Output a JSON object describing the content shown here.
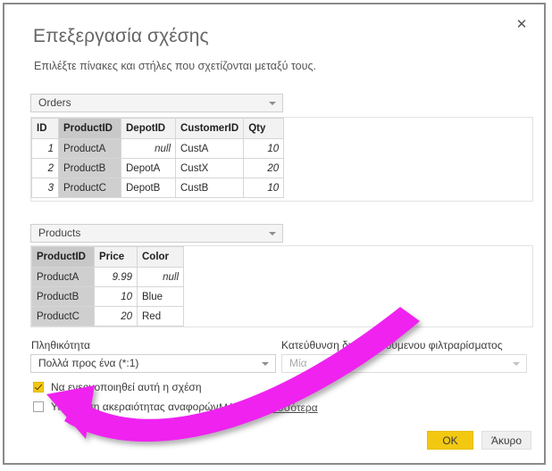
{
  "dialog": {
    "title": "Επεξεργασία σχέσης",
    "subtitle": "Επιλέξτε πίνακες και στήλες που σχετίζονται μεταξύ τους.",
    "close_icon": "close-icon"
  },
  "tables": [
    {
      "select_value": "Orders",
      "chevron_icon": "chevron-down-icon",
      "selected_column": "ProductID",
      "columns": [
        "ID",
        "ProductID",
        "DepotID",
        "CustomerID",
        "Qty"
      ],
      "rows": [
        [
          "1",
          "ProductA",
          "null",
          "CustA",
          "10"
        ],
        [
          "2",
          "ProductB",
          "DepotA",
          "CustX",
          "20"
        ],
        [
          "3",
          "ProductC",
          "DepotB",
          "CustB",
          "10"
        ]
      ]
    },
    {
      "select_value": "Products",
      "chevron_icon": "chevron-down-icon",
      "selected_column": "ProductID",
      "columns": [
        "ProductID",
        "Price",
        "Color"
      ],
      "rows": [
        [
          "ProductA",
          "9.99",
          "null"
        ],
        [
          "ProductB",
          "10",
          "Blue"
        ],
        [
          "ProductC",
          "20",
          "Red"
        ]
      ]
    }
  ],
  "options": {
    "cardinality_label": "Πληθικότητα",
    "cardinality_value": "Πολλά προς ένα (*:1)",
    "cross_filter_label": "Κατεύθυνση διασταυρούμενου φιλτραρίσματος",
    "cross_filter_value": "Μία",
    "active_checkbox_label": "Να ενεργοποιηθεί αυτή η σχέση",
    "active_checkbox_checked": true,
    "integrity_checkbox_label": "Υιοθέτηση ακεραιότητας αναφορών",
    "integrity_checkbox_checked": false,
    "learn_more_link": "Μάθετε περισσότερα"
  },
  "footer": {
    "ok_label": "OK",
    "cancel_label": "Άκυρο"
  },
  "annotation": {
    "arrow_color": "#ef23ef",
    "arrow_target": "Υιοθέτηση ακεραιότητας αναφορών"
  },
  "colors": {
    "accent": "#f2c811",
    "frame_border": "#8a8a8a",
    "title_gray": "#666666",
    "selected_column_bg": "#cfcfcf"
  }
}
